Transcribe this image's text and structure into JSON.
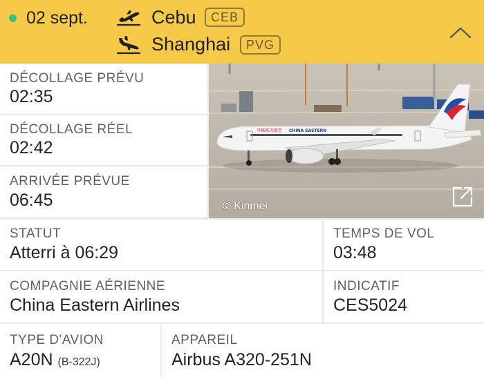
{
  "header": {
    "date": "02 sept.",
    "departure": {
      "city": "Cebu",
      "code": "CEB"
    },
    "arrival": {
      "city": "Shanghai",
      "code": "PVG"
    },
    "status_color": "#34c27a",
    "background": "#f7c948"
  },
  "times": {
    "scheduled_departure": {
      "label": "DÉCOLLAGE PRÉVU",
      "value": "02:35"
    },
    "actual_departure": {
      "label": "DÉCOLLAGE RÉEL",
      "value": "02:42"
    },
    "scheduled_arrival": {
      "label": "ARRIVÉE PRÉVUE",
      "value": "06:45"
    }
  },
  "photo": {
    "credit": "© Kinmei",
    "livery_text": "CHINA EASTERN",
    "livery_cn": "中国东方航空"
  },
  "details": {
    "status": {
      "label": "STATUT",
      "value": "Atterri à 06:29"
    },
    "flight_time": {
      "label": "TEMPS DE VOL",
      "value": "03:48"
    },
    "airline": {
      "label": "COMPAGNIE AÉRIENNE",
      "value": "China Eastern Airlines"
    },
    "callsign": {
      "label": "INDICATIF",
      "value": "CES5024"
    },
    "aircraft_type": {
      "label": "TYPE D'AVION",
      "value": "A20N",
      "registration": "(B-322J)"
    },
    "aircraft": {
      "label": "APPAREIL",
      "value": "Airbus A320-251N"
    }
  }
}
